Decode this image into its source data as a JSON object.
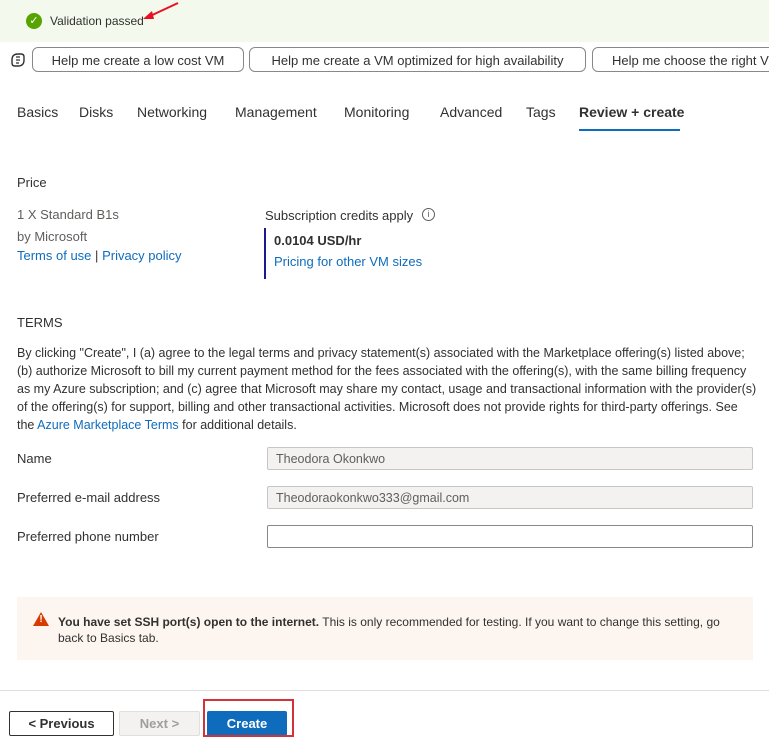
{
  "banner": {
    "text": "Validation passed"
  },
  "copilot": {
    "chips": [
      "Help me create a low cost VM",
      "Help me create a VM optimized for high availability",
      "Help me choose the right VM"
    ]
  },
  "tabs": [
    "Basics",
    "Disks",
    "Networking",
    "Management",
    "Monitoring",
    "Advanced",
    "Tags",
    "Review + create"
  ],
  "price": {
    "heading": "Price",
    "product": "1 X Standard B1s",
    "publisher": "by Microsoft",
    "terms_link": "Terms of use",
    "separator": "|",
    "privacy_link": "Privacy policy",
    "credits_label": "Subscription credits apply",
    "amount": "0.0104 USD/hr",
    "pricing_link": "Pricing for other VM sizes"
  },
  "terms": {
    "heading": "TERMS",
    "body": "By clicking \"Create\", I (a) agree to the legal terms and privacy statement(s) associated with the Marketplace offering(s) listed above; (b) authorize Microsoft to bill my current payment method for the fees associated with the offering(s), with the same billing frequency as my Azure subscription; and (c) agree that Microsoft may share my contact, usage and transactional information with the provider(s) of the offering(s) for support, billing and other transactional activities. Microsoft does not provide rights for third-party offerings. See the ",
    "link": "Azure Marketplace Terms",
    "tail": " for additional details."
  },
  "form": {
    "name_label": "Name",
    "name_value": "Theodora Okonkwo",
    "email_label": "Preferred e-mail address",
    "email_value": "Theodoraokonkwo333@gmail.com",
    "phone_label": "Preferred phone number",
    "phone_value": ""
  },
  "warning": {
    "bold": "You have set SSH port(s) open to the internet.",
    "text": "  This is only recommended for testing.  If you want to change this setting, go back to Basics tab."
  },
  "buttons": {
    "previous": "< Previous",
    "next": "Next >",
    "create": "Create"
  },
  "colors": {
    "accent": "#0f6cbd",
    "success": "#57a300",
    "warning": "#d83b01",
    "highlight": "#d13438"
  }
}
